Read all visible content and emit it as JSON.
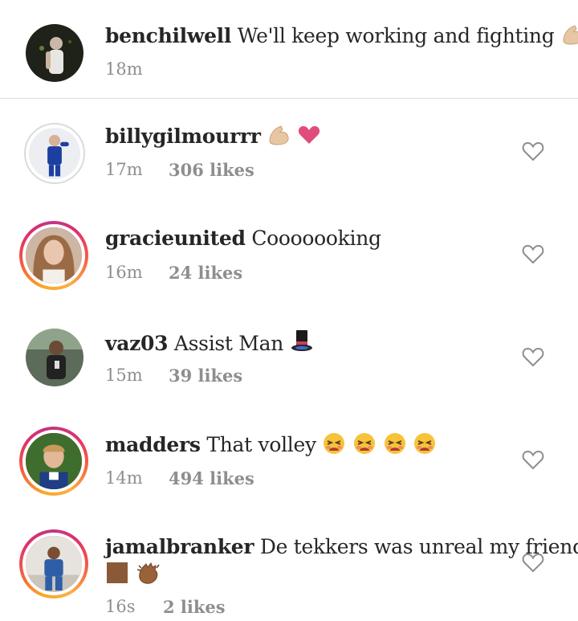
{
  "caption": {
    "username": "benchilwell",
    "text": "We'll keep working and fighting",
    "emoji": "flexed-biceps",
    "time": "18m"
  },
  "comments": [
    {
      "username": "billygilmourrr",
      "text": "",
      "emojis": [
        "flexed-biceps",
        "pink-heart"
      ],
      "time": "17m",
      "likes": "306 likes"
    },
    {
      "username": "gracieunited",
      "text": "Cooooooking",
      "emojis": [],
      "time": "16m",
      "likes": "24 likes"
    },
    {
      "username": "vaz03",
      "text": "Assist Man",
      "emojis": [
        "top-hat"
      ],
      "time": "15m",
      "likes": "39 likes"
    },
    {
      "username": "madders",
      "text": "That volley",
      "emojis": [
        "tired-face",
        "tired-face",
        "tired-face",
        "tired-face"
      ],
      "time": "14m",
      "likes": "494 likes"
    },
    {
      "username": "jamalbranker",
      "text": "De tekkers was unreal my friend",
      "emojis": [
        "brown-square",
        "clapping-hands"
      ],
      "time": "16s",
      "likes": "2 likes"
    }
  ],
  "colors": {
    "muted": "#8e8e8e",
    "text": "#262626",
    "divider": "#dbdbdb",
    "heart_outline": "#8e8e8e"
  }
}
